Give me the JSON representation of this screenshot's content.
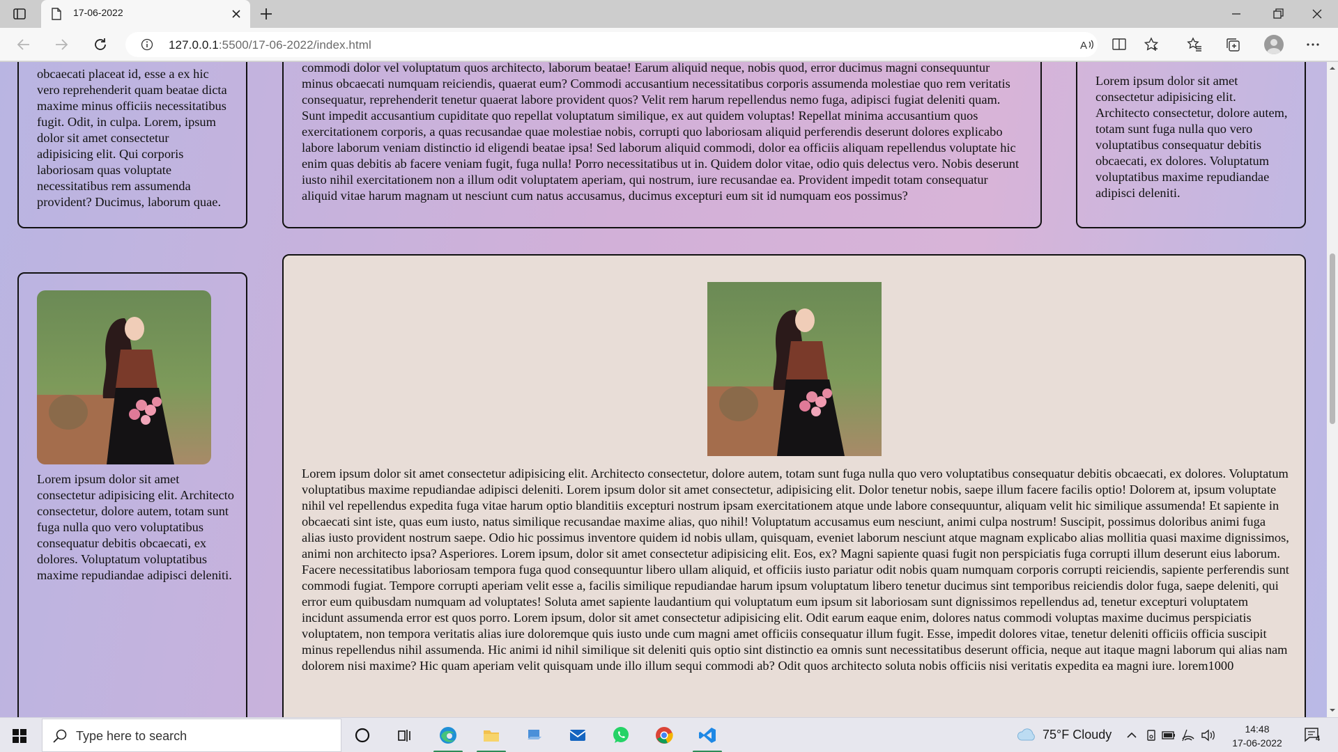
{
  "browser": {
    "tab_title": "17-06-2022",
    "url_host": "127.0.0.1",
    "url_rest": ":5500/17-06-2022/index.html"
  },
  "page": {
    "left_top_text": "obcaecati placeat id, esse a ex hic vero reprehenderit quam beatae dicta maxime minus officiis necessitatibus fugit. Odit, in culpa. Lorem, ipsum dolor sit amet consectetur adipisicing elit. Qui corporis laboriosam quas voluptate necessitatibus rem assumenda provident? Ducimus, laborum quae.",
    "mid_top_text": "commodi dolor vel voluptatum quos architecto, laborum beatae! Earum aliquid neque, nobis quod, error ducimus magni consequuntur minus obcaecati numquam reiciendis, quaerat eum? Commodi accusantium necessitatibus corporis assumenda molestiae quo rem veritatis consequatur, reprehenderit tenetur quaerat labore provident quos? Velit rem harum repellendus nemo fuga, adipisci fugiat deleniti quam. Sunt impedit accusantium cupiditate quo repellat voluptatum similique, ex aut quidem voluptas! Repellat minima accusantium quos exercitationem corporis, a quas recusandae quae molestiae nobis, corrupti quo laboriosam aliquid perferendis deserunt dolores explicabo labore laborum veniam distinctio id eligendi beatae ipsa! Sed laborum aliquid commodi, dolor ea officiis aliquam repellendus voluptate hic enim quas debitis ab facere veniam fugit, fuga nulla! Porro necessitatibus ut in. Quidem dolor vitae, odio quis delectus vero. Nobis deserunt iusto nihil exercitationem non a illum odit voluptatem aperiam, qui nostrum, iure recusandae ea. Provident impedit totam consequatur aliquid vitae harum magnam ut nesciunt cum natus accusamus, ducimus excepturi eum sit id numquam eos possimus?",
    "right_top_text": "Lorem ipsum dolor sit amet consectetur adipisicing elit. Architecto consectetur, dolore autem, totam sunt fuga nulla quo vero voluptatibus consequatur debitis obcaecati, ex dolores. Voluptatum voluptatibus maxime repudiandae adipisci deleniti.",
    "left_bottom_text": "Lorem ipsum dolor sit amet consectetur adipisicing elit. Architecto consectetur, dolore autem, totam sunt fuga nulla quo vero voluptatibus consequatur debitis obcaecati, ex dolores. Voluptatum voluptatibus maxime repudiandae adipisci deleniti.",
    "main_text": "Lorem ipsum dolor sit amet consectetur adipisicing elit. Architecto consectetur, dolore autem, totam sunt fuga nulla quo vero voluptatibus consequatur debitis obcaecati, ex dolores. Voluptatum voluptatibus maxime repudiandae adipisci deleniti. Lorem ipsum dolor sit amet consectetur, adipisicing elit. Dolor tenetur nobis, saepe illum facere facilis optio! Dolorem at, ipsum voluptate nihil vel repellendus expedita fuga vitae harum optio blanditiis excepturi nostrum ipsam exercitationem atque unde labore consequuntur, aliquam velit hic similique assumenda! Et sapiente in obcaecati sint iste, quas eum iusto, natus similique recusandae maxime alias, quo nihil! Voluptatum accusamus eum nesciunt, animi culpa nostrum! Suscipit, possimus doloribus animi fuga alias iusto provident nostrum saepe. Odio hic possimus inventore quidem id nobis ullam, quisquam, eveniet laborum nesciunt atque magnam explicabo alias mollitia quasi maxime dignissimos, animi non architecto ipsa? Asperiores. Lorem ipsum, dolor sit amet consectetur adipisicing elit. Eos, ex? Magni sapiente quasi fugit non perspiciatis fuga corrupti illum deserunt eius laborum. Facere necessitatibus laboriosam tempora fuga quod consequuntur libero ullam aliquid, et officiis iusto pariatur odit nobis quam numquam corporis corrupti reiciendis, sapiente perferendis sunt commodi fugiat. Tempore corrupti aperiam velit esse a, facilis similique repudiandae harum ipsum voluptatum libero tenetur ducimus sint temporibus reiciendis dolor fuga, saepe deleniti, qui error eum quibusdam numquam ad voluptates! Soluta amet sapiente laudantium qui voluptatum eum ipsum sit laboriosam sunt dignissimos repellendus ad, tenetur excepturi voluptatem incidunt assumenda error est quos porro. Lorem ipsum, dolor sit amet consectetur adipisicing elit. Odit earum eaque enim, dolores natus commodi voluptas maxime ducimus perspiciatis voluptatem, non tempora veritatis alias iure doloremque quis iusto unde cum magni amet officiis consequatur illum fugit. Esse, impedit dolores vitae, tenetur deleniti officiis officia suscipit minus repellendus nihil assumenda. Hic animi id nihil similique sit deleniti quis optio sint distinctio ea omnis sunt necessitatibus deserunt officia, neque aut itaque magni laborum qui alias nam dolorem nisi maxime? Hic quam aperiam velit quisquam unde illo illum sequi commodi ab? Odit quos architecto soluta nobis officiis nisi veritatis expedita ea magni iure. lorem1000"
  },
  "taskbar": {
    "search_placeholder": "Type here to search",
    "weather": "75°F  Cloudy",
    "time": "14:48",
    "date": "17-06-2022",
    "notification_count": "4"
  },
  "colors": {
    "page_gradient_start": "#b9b5e2",
    "page_gradient_mid": "#d2b0d8",
    "main_card_bg": "#e8ddd7",
    "taskbar_bg": "#e7e7ee"
  }
}
